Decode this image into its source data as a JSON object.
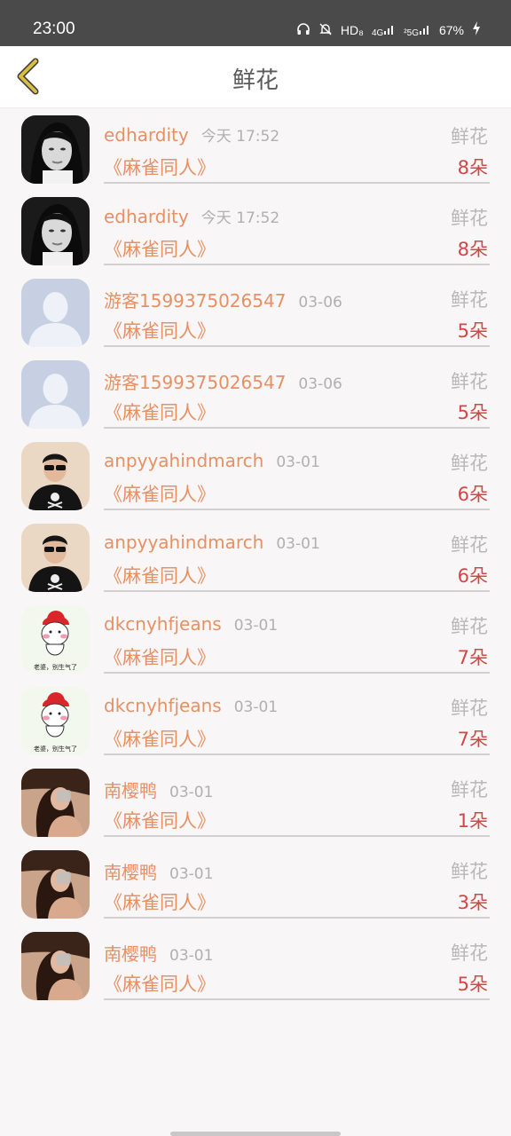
{
  "status_bar": {
    "time": "23:00",
    "headphones_icon": "headphones-icon",
    "bell_off_icon": "bell-off-icon",
    "hd_label": "HD₈",
    "signal_4g": "4G",
    "signal_5g": "²5G",
    "battery": "67%"
  },
  "header": {
    "title": "鲜花"
  },
  "items": [
    {
      "user": "edhardity",
      "time": "今天 17:52",
      "gift": "鲜花",
      "book": "《麻雀同人》",
      "count": "8朵",
      "avatar": "dark-portrait"
    },
    {
      "user": "edhardity",
      "time": "今天 17:52",
      "gift": "鲜花",
      "book": "《麻雀同人》",
      "count": "8朵",
      "avatar": "dark-portrait"
    },
    {
      "user": "游客1599375026547",
      "time": "03-06",
      "gift": "鲜花",
      "book": "《麻雀同人》",
      "count": "5朵",
      "avatar": "default-silhouette"
    },
    {
      "user": "游客1599375026547",
      "time": "03-06",
      "gift": "鲜花",
      "book": "《麻雀同人》",
      "count": "5朵",
      "avatar": "default-silhouette"
    },
    {
      "user": "anpyyahindmarch",
      "time": "03-01",
      "gift": "鲜花",
      "book": "《麻雀同人》",
      "count": "6朵",
      "avatar": "sunglasses-man"
    },
    {
      "user": "anpyyahindmarch",
      "time": "03-01",
      "gift": "鲜花",
      "book": "《麻雀同人》",
      "count": "6朵",
      "avatar": "sunglasses-man"
    },
    {
      "user": "dkcnyhfjeans",
      "time": "03-01",
      "gift": "鲜花",
      "book": "《麻雀同人》",
      "count": "7朵",
      "avatar": "cartoon-sticker",
      "avatar_caption": "老婆，别生气了"
    },
    {
      "user": "dkcnyhfjeans",
      "time": "03-01",
      "gift": "鲜花",
      "book": "《麻雀同人》",
      "count": "7朵",
      "avatar": "cartoon-sticker",
      "avatar_caption": "老婆，别生气了"
    },
    {
      "user": "南樱鸭",
      "time": "03-01",
      "gift": "鲜花",
      "book": "《麻雀同人》",
      "count": "1朵",
      "avatar": "girl-photo"
    },
    {
      "user": "南樱鸭",
      "time": "03-01",
      "gift": "鲜花",
      "book": "《麻雀同人》",
      "count": "3朵",
      "avatar": "girl-photo"
    },
    {
      "user": "南樱鸭",
      "time": "03-01",
      "gift": "鲜花",
      "book": "《麻雀同人》",
      "count": "5朵",
      "avatar": "girl-photo"
    }
  ],
  "colors": {
    "accent": "#e79064",
    "count": "#d54545",
    "back_arrow": "#c9b13c"
  }
}
